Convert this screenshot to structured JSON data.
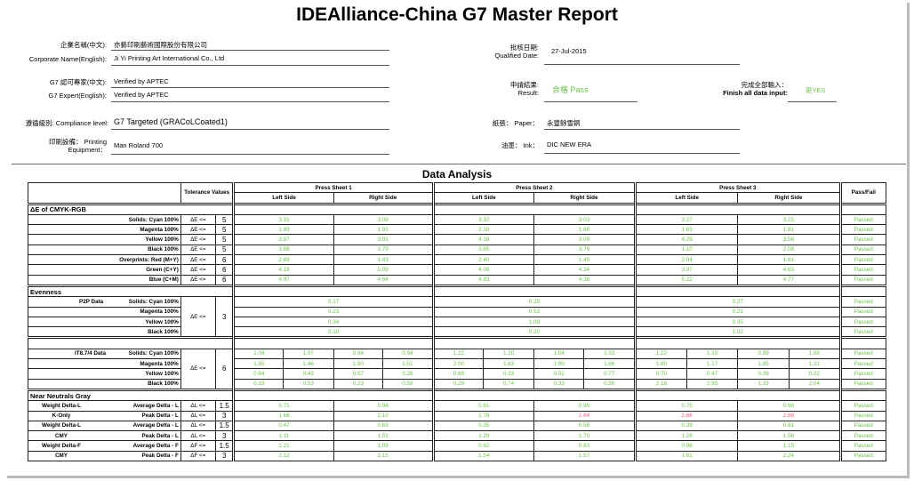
{
  "title": "IDEAlliance-China G7 Master Report",
  "header": {
    "company_cn_label": "企業名稱(中文):",
    "company_cn_value": "亦藝印刷藝術國際股份有限公司",
    "company_en_label": "Corporate Name(English):",
    "company_en_value": "Ji Yi Printing Art International Co., Ltd",
    "expert_cn_label": "G7 認可專家(中文):",
    "expert_cn_value": "Verified by APTEC",
    "expert_en_label": "G7 Expert(English):",
    "expert_en_value": "Verified by APTEC",
    "compliance_label": "遵循級別: Compliance level:",
    "compliance_value": "G7 Targeted (GRACoLCoated1)",
    "equipment_label_1": "印刷設備： Printing",
    "equipment_label_2": "Equipment：",
    "equipment_value": "Man Roland 700",
    "qualified_label_1": "批核日期:",
    "qualified_label_2": "Qualified Date:",
    "qualified_value": "27-Jul-2015",
    "result_label_1": "申請結果:",
    "result_label_2": "Result:",
    "result_value": "合格 Pass",
    "finish_label_1": "完成全部輸入：",
    "finish_label_2": "Finish all data input:",
    "finish_value": "是YES",
    "paper_label": "紙張： Paper：",
    "paper_value": "永豐餘雪銅",
    "ink_label": "油墨： Ink：",
    "ink_value": "DIC NEW ERA"
  },
  "data_analysis": {
    "title": "Data Analysis",
    "tolerance_header": "Tolerance Values",
    "pass_fail_header": "Pass/Fail",
    "sheets": [
      "Press Sheet 1",
      "Press Sheet 2",
      "Press Sheet 3"
    ],
    "left_side": "Left Side",
    "right_side": "Right Side",
    "section_cmyk": "ΔE of CMYK-RGB",
    "section_evenness": "Evenness",
    "section_gray": "Near Neutrals Gray",
    "cmyk_rows": [
      {
        "label": "Solids: Cyan 100%",
        "sym": "ΔE <=",
        "tol": "5",
        "v": [
          "3.15",
          "3.08",
          "3.32",
          "3.03",
          "3.27",
          "3.15"
        ],
        "pf": "Passed"
      },
      {
        "label": "Magenta 100%",
        "sym": "ΔE <=",
        "tol": "5",
        "v": [
          "1.89",
          "1.91",
          "2.16",
          "1.86",
          "1.83",
          "1.81"
        ],
        "pf": "Passed"
      },
      {
        "label": "Yellow 100%",
        "sym": "ΔE <=",
        "tol": "5",
        "v": [
          "3.97",
          "3.91",
          "4.16",
          "3.09",
          "4.29",
          "3.56"
        ],
        "pf": "Passed"
      },
      {
        "label": "Black 100%",
        "sym": "ΔE <=",
        "tol": "5",
        "v": [
          "3.88",
          "3.79",
          "3.65",
          "3.79",
          "1.10",
          "2.08"
        ],
        "pf": "Passed"
      },
      {
        "label": "Overprints: Red (M+Y)",
        "sym": "ΔE <=",
        "tol": "6",
        "v": [
          "2.69",
          "1.43",
          "2.40",
          "1.49",
          "2.04",
          "1.61"
        ],
        "pf": "Passed"
      },
      {
        "label": "Green (C+Y)",
        "sym": "ΔE <=",
        "tol": "6",
        "v": [
          "4.18",
          "5.09",
          "4.06",
          "4.34",
          "3.97",
          "4.63"
        ],
        "pf": "Passed"
      },
      {
        "label": "Blue (C+M)",
        "sym": "ΔE <=",
        "tol": "6",
        "v": [
          "4.97",
          "4.64",
          "4.83",
          "4.36",
          "5.22",
          "4.77"
        ],
        "pf": "Passed"
      }
    ],
    "p2p_label": "P2P Data",
    "p2p_sym": "ΔE <=",
    "p2p_tol": "3",
    "p2p_rows": [
      {
        "label": "Solids: Cyan 100%",
        "v": [
          "0.17",
          "0.25",
          "0.27"
        ],
        "pf": "Passed"
      },
      {
        "label": "Magenta 100%",
        "v": [
          "0.23",
          "0.53",
          "0.21"
        ],
        "pf": "Passed"
      },
      {
        "label": "Yellow 100%",
        "v": [
          "0.34",
          "1.09",
          "0.35"
        ],
        "pf": "Passed"
      },
      {
        "label": "Black 100%",
        "v": [
          "0.10",
          "0.20",
          "1.02"
        ],
        "pf": "Passed"
      }
    ],
    "it8_label": "IT8.7/4 Data",
    "it8_sym": "ΔE <=",
    "it8_tol": "6",
    "it8_rows": [
      {
        "label": "Solids: Cyan 100%",
        "v": [
          "1.04",
          "1.07",
          "0.94",
          "0.94",
          "1.22",
          "1.20",
          "1.04",
          "1.03",
          "1.22",
          "1.33",
          "0.99",
          "1.08"
        ],
        "pf": "Passed"
      },
      {
        "label": "Magenta 100%",
        "v": [
          "1.85",
          "1.46",
          "1.90",
          "1.51",
          "2.00",
          "1.63",
          "1.90",
          "1.66",
          "1.80",
          "1.17",
          "1.85",
          "1.31"
        ],
        "pf": "Passed"
      },
      {
        "label": "Yellow 100%",
        "v": [
          "0.64",
          "0.43",
          "0.57",
          "0.26",
          "0.69",
          "0.33",
          "0.51",
          "0.77",
          "0.70",
          "0.47",
          "0.39",
          "0.22"
        ],
        "pf": "Passed"
      },
      {
        "label": "Black 100%",
        "v": [
          "0.33",
          "0.53",
          "0.23",
          "0.59",
          "0.29",
          "0.74",
          "0.33",
          "0.56",
          "2.18",
          "2.95",
          "1.33",
          "2.04"
        ],
        "pf": "Passed"
      }
    ],
    "gray_rows": [
      {
        "group": "Weight Delta-L",
        "label": "Average Delta - L",
        "sym": "ΔL <=",
        "tol": "1.5",
        "v": [
          "0.71",
          "0.94",
          "0.61",
          "0.99",
          "0.75",
          "0.98"
        ],
        "red": [],
        "pf": "Passed"
      },
      {
        "group": "K-Only",
        "label": "Peak Delta - L",
        "sym": "ΔL <=",
        "tol": "3",
        "v": [
          "1.66",
          "2.10",
          "1.78",
          "2.84",
          "2.66",
          "2.68"
        ],
        "red": [
          3,
          4,
          5
        ],
        "pf": "Passed"
      },
      {
        "group": "Weight Delta-L",
        "label": "Average Delta - L",
        "sym": "ΔL <=",
        "tol": "1.5",
        "v": [
          "0.47",
          "0.63",
          "0.35",
          "0.58",
          "0.39",
          "0.61"
        ],
        "red": [],
        "pf": "Passed"
      },
      {
        "group": "CMY",
        "label": "Peak Delta - L",
        "sym": "ΔL <=",
        "tol": "3",
        "v": [
          "1.11",
          "1.51",
          "1.29",
          "1.70",
          "1.26",
          "1.56"
        ],
        "red": [],
        "pf": "Passed"
      },
      {
        "group": "Weight Delta-F",
        "label": "Average Delta - F",
        "sym": "ΔF <=",
        "tol": "1.5",
        "v": [
          "1.21",
          "1.09",
          "0.82",
          "0.83",
          "0.96",
          "1.15"
        ],
        "red": [],
        "pf": "Passed"
      },
      {
        "group": "CMY",
        "label": "Peak Delta - F",
        "sym": "ΔF <=",
        "tol": "3",
        "v": [
          "2.12",
          "2.15",
          "1.54",
          "1.57",
          "1.91",
          "2.24"
        ],
        "red": [],
        "pf": "Passed"
      }
    ]
  }
}
